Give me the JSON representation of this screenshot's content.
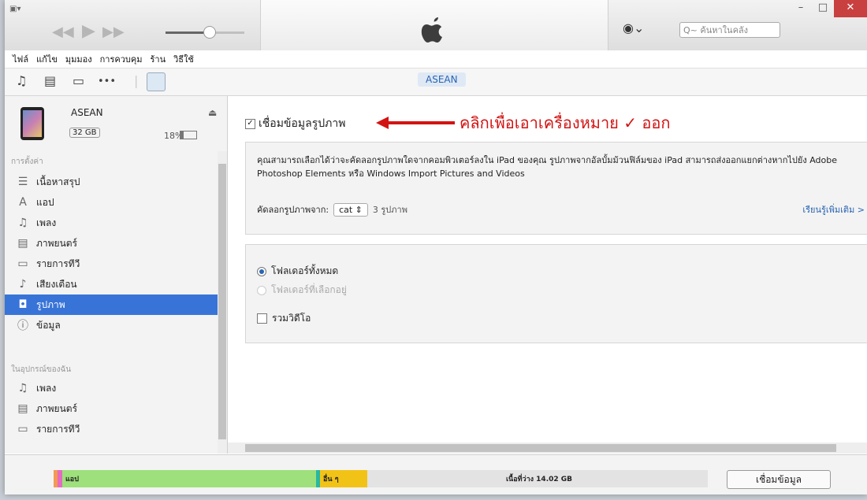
{
  "toolbar": {
    "search_placeholder": "Q~ ค้นหาในคลัง",
    "volume": 0.55
  },
  "menu": [
    "ไฟล์",
    "แก้ไข",
    "มุมมอง",
    "การควบคุม",
    "ร้าน",
    "วิธีใช้"
  ],
  "source": {
    "device_button": "ASEAN"
  },
  "device": {
    "name": "ASEAN",
    "capacity": "32 GB",
    "battery": "18%"
  },
  "sidebar": {
    "settings_header": "การตั้งค่า",
    "settings_items": [
      {
        "label": "เนื้อหาสรุป",
        "icon": "summary-icon"
      },
      {
        "label": "แอป",
        "icon": "apps-icon"
      },
      {
        "label": "เพลง",
        "icon": "music-icon"
      },
      {
        "label": "ภาพยนตร์",
        "icon": "film-icon"
      },
      {
        "label": "รายการทีวี",
        "icon": "tv-icon"
      },
      {
        "label": "เสียงเตือน",
        "icon": "bell-icon"
      },
      {
        "label": "รูปภาพ",
        "icon": "camera-icon"
      },
      {
        "label": "ข้อมูล",
        "icon": "info-icon"
      }
    ],
    "device_header": "ในอุปกรณ์ของฉัน",
    "device_items": [
      {
        "label": "เพลง",
        "icon": "music-icon"
      },
      {
        "label": "ภาพยนตร์",
        "icon": "film-icon"
      },
      {
        "label": "รายการทีวี",
        "icon": "tv-icon"
      }
    ]
  },
  "main": {
    "sync_label": "เชื่อมข้อมูลรูปภาพ",
    "annotation": "คลิกเพื่อเอาเครื่องหมาย ✓ ออก",
    "description": "คุณสามารถเลือกได้ว่าจะคัดลอกรูปภาพใดจากคอมพิวเตอร์ลงใน iPad ของคุณ รูปภาพจากอัลบั้มม้วนฟิล์มของ iPad สามารถส่งออกแยกต่างหากไปยัง Adobe Photoshop Elements หรือ Windows Import Pictures and Videos",
    "copy_from_label": "คัดลอกรูปภาพจาก:",
    "copy_from_value": "cat",
    "photo_count": "3 รูปภาพ",
    "learn_more": "เรียนรู้เพิ่มเติม >",
    "option_all": "โฟลเดอร์ทั้งหมด",
    "option_selected": "โฟลเดอร์ที่เลือกอยู่",
    "include_videos": "รวมวิดีโอ"
  },
  "storage": {
    "apps_label": "แอป",
    "other_label": "อื่น ๆ",
    "free_label": "เนื้อที่ว่าง 14.02 GB",
    "colors": {
      "apps": "#9ee07b",
      "other": "#f2c317",
      "free": "#e3e3e3",
      "pink": "#e56bc0",
      "orange": "#f59a52"
    }
  },
  "sync_button": "เชื่อมข้อมูล"
}
